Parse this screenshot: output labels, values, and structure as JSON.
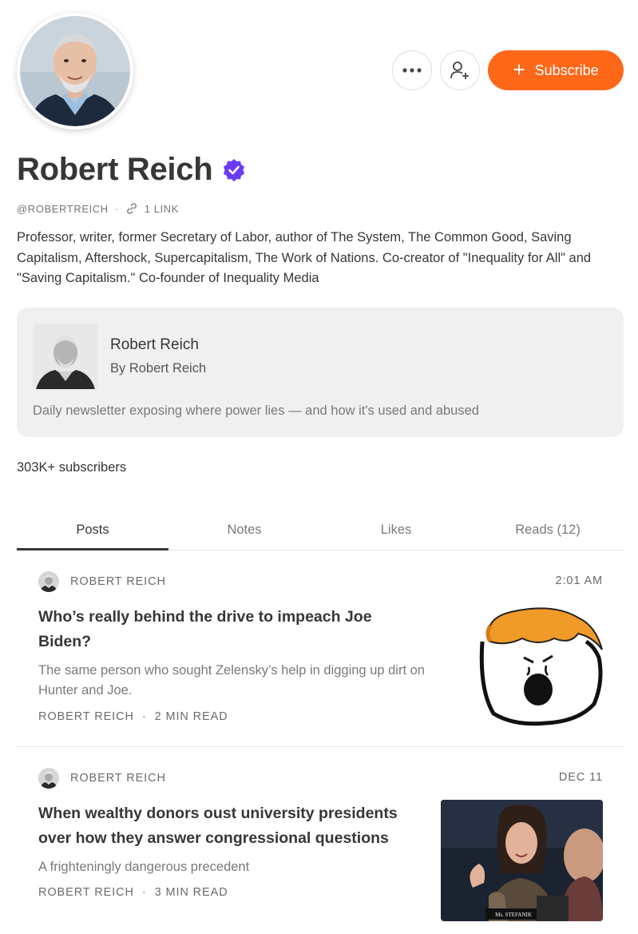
{
  "profile": {
    "name": "Robert Reich",
    "handle": "@ROBERTREICH",
    "links_label": "1 LINK",
    "bio": "Professor, writer, former Secretary of Labor, author of The System, The Common Good, Saving Capitalism, Aftershock, Supercapitalism, The Work of Nations. Co-creator of \"Inequality for All\" and \"Saving Capitalism.\" Co-founder of Inequality Media",
    "subscribers": "303K+ subscribers"
  },
  "actions": {
    "more_icon": "more-horizontal-icon",
    "follow_icon": "add-user-icon",
    "subscribe_label": "Subscribe",
    "subscribe_icon": "plus-icon"
  },
  "publication": {
    "name": "Robert Reich",
    "by_line": "By Robert Reich",
    "description": "Daily newsletter exposing where power lies — and how it's used and abused"
  },
  "tabs": [
    {
      "label": "Posts",
      "active": true
    },
    {
      "label": "Notes",
      "active": false
    },
    {
      "label": "Likes",
      "active": false
    },
    {
      "label": "Reads (12)",
      "active": false
    }
  ],
  "posts": [
    {
      "author": "ROBERT REICH",
      "date": "2:01 AM",
      "title": "Who’s really behind the drive to impeach Joe Biden?",
      "subtitle": "The same person who sought Zelensky’s help in digging up dirt on Hunter and Joe.",
      "meta_author": "ROBERT REICH",
      "read_time": "2 MIN READ"
    },
    {
      "author": "ROBERT REICH",
      "date": "DEC 11",
      "title": "When wealthy donors oust university presidents over how they answer congressional questions",
      "subtitle": "A frighteningly dangerous precedent",
      "meta_author": "ROBERT REICH",
      "read_time": "3 MIN READ",
      "thumb_caption": "Ms. STEFANIK"
    }
  ],
  "colors": {
    "accent": "#ff6719",
    "verified": "#6c3bf5",
    "text": "#363737",
    "muted": "#7a7a7a"
  }
}
